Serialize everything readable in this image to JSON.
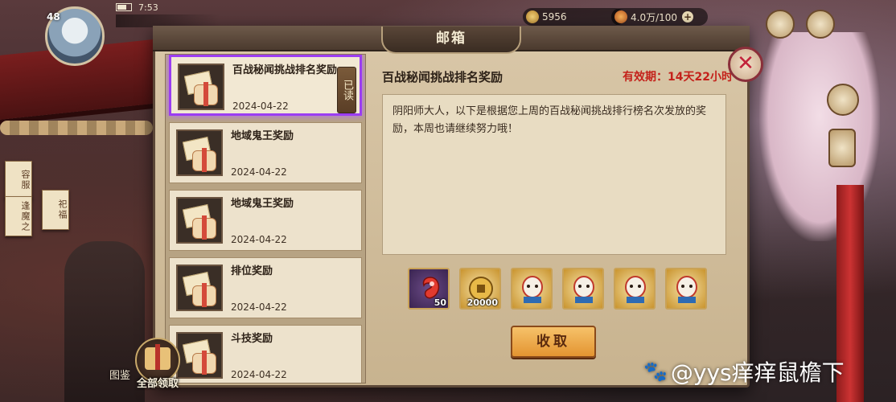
{
  "window": {
    "title": "邮箱"
  },
  "hud": {
    "level": "48",
    "clock": "7:53",
    "currency_1": "5956",
    "currency_2": "4.0万/100",
    "plus": "+"
  },
  "sidebar": {
    "tag_1": "容服",
    "tag_2": "逢魔之",
    "tag_3": "祀福"
  },
  "mail_list": {
    "items": [
      {
        "title": "百战秘闻挑战排名奖励",
        "date": "2024-04-22",
        "read_label": "已读",
        "selected": true
      },
      {
        "title": "地域鬼王奖励",
        "date": "2024-04-22"
      },
      {
        "title": "地域鬼王奖励",
        "date": "2024-04-22"
      },
      {
        "title": "排位奖励",
        "date": "2024-04-22"
      },
      {
        "title": "斗技奖励",
        "date": "2024-04-22"
      }
    ]
  },
  "detail": {
    "title": "百战秘闻挑战排名奖励",
    "expiry": "有效期：14天22小时",
    "body": "阴阳师大人，以下是根据您上周的百战秘闻挑战排行榜名次发放的奖励，本周也请继续努力哦！",
    "rewards": [
      {
        "icon": "magatama-icon",
        "qty": "50"
      },
      {
        "icon": "gold-coin-icon",
        "qty": "20000"
      },
      {
        "icon": "daruma-mask-icon",
        "qty": ""
      },
      {
        "icon": "daruma-mask-icon",
        "qty": ""
      },
      {
        "icon": "daruma-mask-icon",
        "qty": ""
      },
      {
        "icon": "daruma-mask-icon",
        "qty": ""
      }
    ],
    "claim_label": "收取"
  },
  "footer": {
    "claim_all_label": "全部领取",
    "codex_label": "图鉴"
  },
  "watermark": "@yys痒痒鼠檐下",
  "colors": {
    "selection": "#9b3df2",
    "expiry_red": "#c4221b",
    "claim_button": "#e39431"
  }
}
